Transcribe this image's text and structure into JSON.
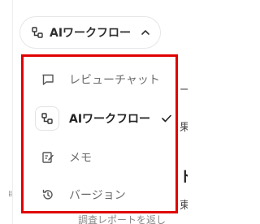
{
  "trigger": {
    "label": "AIワークフロー"
  },
  "menu": {
    "items": [
      {
        "label": "レビューチャット",
        "icon": "chat-bubble-icon",
        "selected": false
      },
      {
        "label": "AIワークフロー",
        "icon": "workflow-icon",
        "selected": true
      },
      {
        "label": "メモ",
        "icon": "memo-edit-icon",
        "selected": false
      },
      {
        "label": "バージョン",
        "icon": "history-icon",
        "selected": false
      }
    ]
  },
  "background": {
    "fragments": [
      "ー",
      "果",
      "ト",
      "東",
      "調査レポートを返し"
    ]
  },
  "colors": {
    "highlight_border": "#e00000",
    "text_primary": "#222222",
    "text_secondary": "#6b6b6b"
  }
}
